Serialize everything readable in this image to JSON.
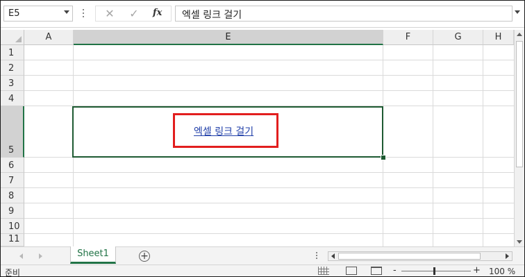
{
  "formula_bar": {
    "name_box": "E5",
    "cancel_icon": "✕",
    "enter_icon": "✓",
    "fx_label": "fx",
    "formula_value": "엑셀 링크 걸기"
  },
  "columns": [
    "A",
    "E",
    "F",
    "G",
    "H"
  ],
  "rows": [
    "1",
    "2",
    "3",
    "4",
    "5",
    "6",
    "7",
    "8",
    "9",
    "10",
    "11"
  ],
  "active_cell": {
    "ref": "E5",
    "text": "엑셀 링크 걸기",
    "link_color": "#1f3ea8"
  },
  "highlight_color": "#e21e1e",
  "accent_color": "#217346",
  "sheet_tabs": [
    "Sheet1"
  ],
  "status": {
    "ready": "준비",
    "zoom_minus": "-",
    "zoom_plus": "+",
    "zoom": "100 %"
  },
  "icons": [
    "dropdown-arrow-icon",
    "cancel-icon",
    "enter-icon",
    "function-icon",
    "add-sheet-icon",
    "normal-view-icon",
    "page-layout-icon",
    "page-break-icon"
  ]
}
